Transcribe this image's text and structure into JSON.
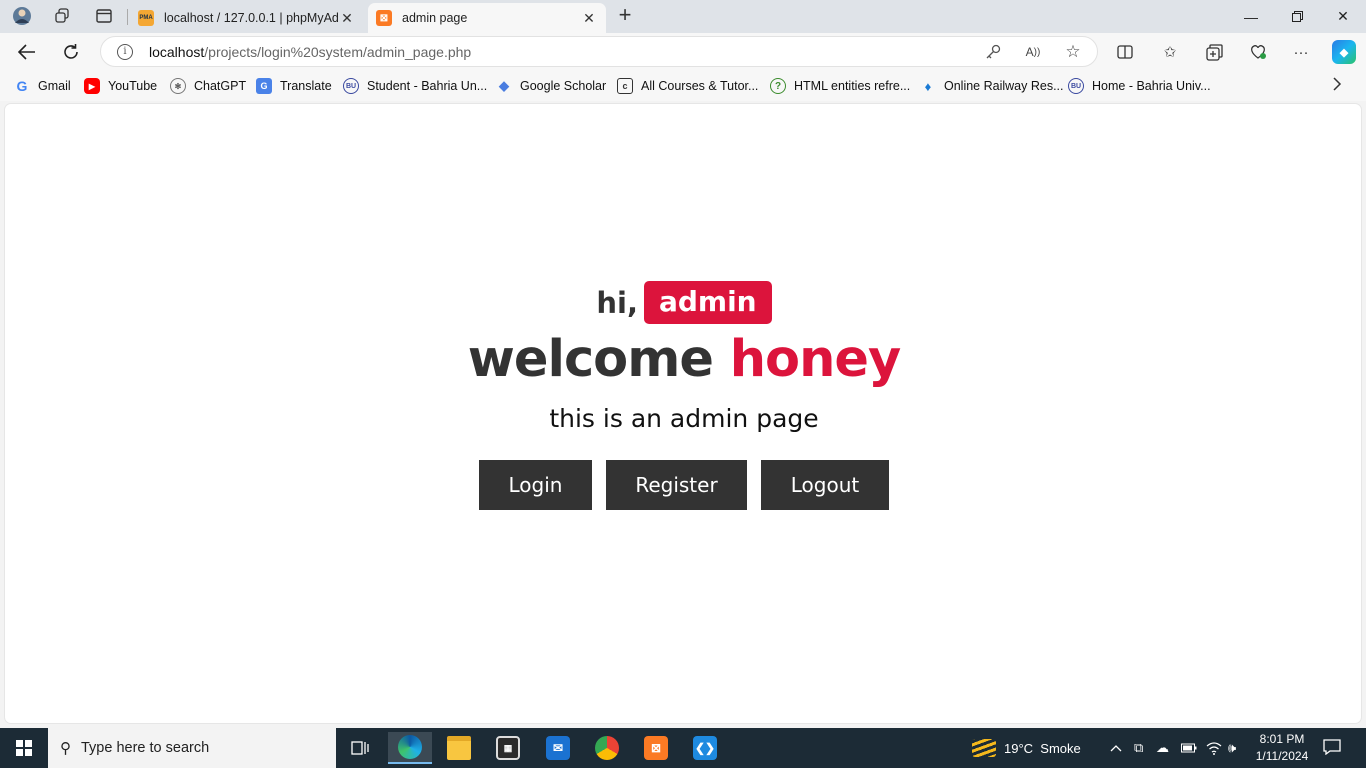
{
  "browser": {
    "tabs": [
      {
        "title": "localhost / 127.0.0.1 | phpMyAdmin",
        "favicon": "phpmyadmin-icon",
        "active": false
      },
      {
        "title": "admin page",
        "favicon": "xampp-icon",
        "active": true
      }
    ],
    "address": {
      "host": "localhost",
      "path": "/projects/login%20system/admin_page.php"
    },
    "favorites": [
      {
        "label": "Gmail",
        "icon": "gmail-icon"
      },
      {
        "label": "YouTube",
        "icon": "youtube-icon"
      },
      {
        "label": "ChatGPT",
        "icon": "chatgpt-icon"
      },
      {
        "label": "Translate",
        "icon": "translate-icon"
      },
      {
        "label": "Student - Bahria Un...",
        "icon": "bahria-icon"
      },
      {
        "label": "Google Scholar",
        "icon": "scholar-icon"
      },
      {
        "label": "All Courses & Tutor...",
        "icon": "courses-icon"
      },
      {
        "label": "HTML entities refre...",
        "icon": "help-icon"
      },
      {
        "label": "Online Railway Res...",
        "icon": "railway-icon"
      },
      {
        "label": "Home - Bahria Univ...",
        "icon": "bahria-icon"
      }
    ]
  },
  "page": {
    "greeting": "hi,",
    "user_badge": "admin",
    "welcome_prefix": "welcome",
    "welcome_name": "honey",
    "subtitle": "this is an admin page",
    "buttons": {
      "login": "Login",
      "register": "Register",
      "logout": "Logout"
    },
    "colors": {
      "accent": "#dc143c",
      "text": "#333333",
      "button_bg": "#333333"
    }
  },
  "taskbar": {
    "search_placeholder": "Type here to search",
    "weather": {
      "temp": "19°C",
      "condition": "Smoke"
    },
    "time": "8:01 PM",
    "date": "1/11/2024"
  }
}
